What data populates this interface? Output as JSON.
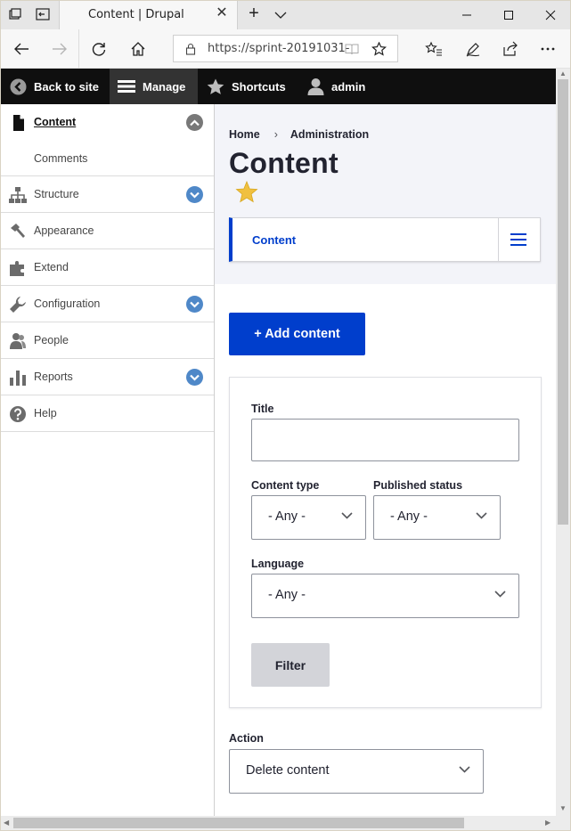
{
  "browser": {
    "tab_title": "Content | Drupal",
    "url": "https://sprint-20191031-"
  },
  "toolbar": {
    "back_to_site": "Back to site",
    "manage": "Manage",
    "shortcuts": "Shortcuts",
    "user": "admin"
  },
  "sidebar": {
    "items": [
      {
        "label": "Content",
        "icon": "file-icon",
        "expanded": true
      },
      {
        "label": "Structure",
        "icon": "sitemap-icon"
      },
      {
        "label": "Appearance",
        "icon": "brush-icon"
      },
      {
        "label": "Extend",
        "icon": "puzzle-icon"
      },
      {
        "label": "Configuration",
        "icon": "wrench-icon"
      },
      {
        "label": "People",
        "icon": "people-icon"
      },
      {
        "label": "Reports",
        "icon": "bar-chart-icon"
      },
      {
        "label": "Help",
        "icon": "help-icon"
      }
    ],
    "sub_items": [
      "Comments"
    ]
  },
  "breadcrumb": [
    "Home",
    "Administration"
  ],
  "page_title": "Content",
  "tabs": {
    "active": "Content"
  },
  "add_button": "+ Add content",
  "filters": {
    "title_label": "Title",
    "title_value": "",
    "content_type_label": "Content type",
    "content_type_value": "- Any -",
    "published_label": "Published status",
    "published_value": "- Any -",
    "language_label": "Language",
    "language_value": "- Any -",
    "filter_button": "Filter"
  },
  "action": {
    "label": "Action",
    "value": "Delete content"
  },
  "colors": {
    "primary": "#003ecc",
    "toolbar_bg": "#0f0f0f",
    "toggle_blue": "#4f88c8",
    "star": "#f0c040"
  }
}
